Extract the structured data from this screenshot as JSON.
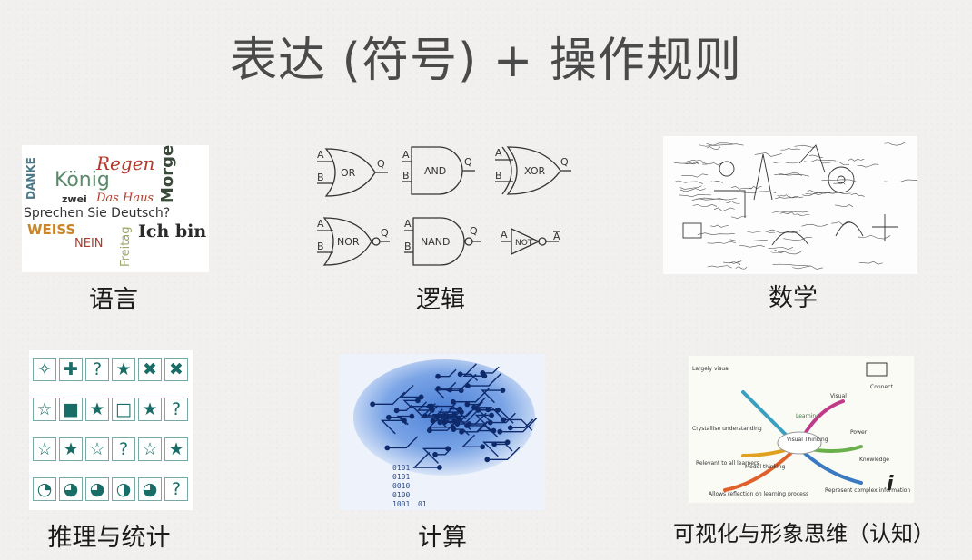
{
  "title": "表达 (符号) + 操作规则",
  "captions": {
    "language": "语言",
    "logic": "逻辑",
    "math": "数学",
    "reasoning": "推理与统计",
    "computation": "计算",
    "visual": "可视化与形象思维（认知）"
  },
  "language_words": [
    "Regen",
    "DANKE",
    "König",
    "Morgen",
    "zwei",
    "Das Haus",
    "Sprechen Sie Deutsch?",
    "WEISS",
    "Freitag",
    "Ich bin",
    "NEIN"
  ],
  "logic_gates": {
    "or": {
      "label": "OR",
      "in_a": "A",
      "in_b": "B",
      "out": "Q"
    },
    "and": {
      "label": "AND",
      "in_a": "A",
      "in_b": "B",
      "out": "Q"
    },
    "xor": {
      "label": "XOR",
      "in_a": "A",
      "in_b": "B",
      "out": "Q"
    },
    "nor": {
      "label": "NOR",
      "in_a": "A",
      "in_b": "B",
      "out": "Q"
    },
    "nand": {
      "label": "NAND",
      "in_a": "A",
      "in_b": "B",
      "out": "Q"
    },
    "not": {
      "label": "NOT",
      "in_a": "A",
      "out": "A"
    }
  },
  "puzzle_grid": [
    [
      "✧",
      "✚",
      "?",
      "★",
      "✖",
      "✖"
    ],
    [
      "☆",
      "■",
      "★",
      "□",
      "★",
      "?"
    ],
    [
      "☆",
      "★",
      "☆",
      "?",
      "☆",
      "★"
    ],
    [
      "◔",
      "◕",
      "◕",
      "◑",
      "◕",
      "?"
    ]
  ],
  "brain_digits": [
    "0101",
    "0101",
    "0010",
    "0100",
    "1001",
    "01"
  ],
  "mind_map": {
    "center": "Visual Thinking",
    "branches": [
      "Largely visual",
      "Learning",
      "Crystallise understanding",
      "Relevant to all learners",
      "Model thinking",
      "Allows reflection on learning process",
      "Power",
      "Knowledge",
      "Represent complex information",
      "Visual",
      "Connect"
    ]
  },
  "colors": {
    "title": "#4a4a4a",
    "grid_teal": "#1a6d67",
    "brain_blue": "#2a5fb8"
  }
}
